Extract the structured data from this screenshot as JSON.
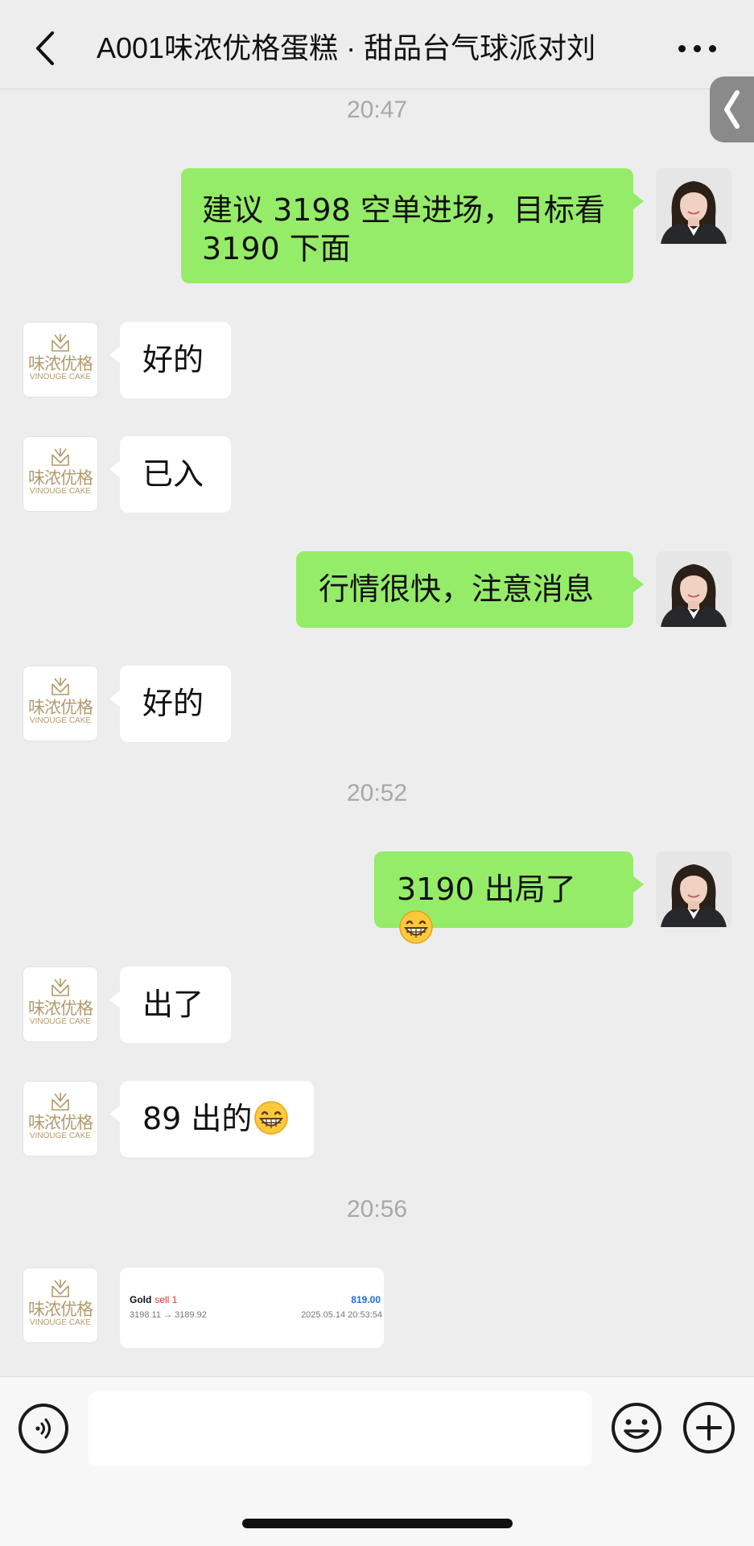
{
  "header": {
    "title": "A001味浓优格蛋糕 · 甜品台气球派对刘",
    "back_icon": "chevron-left-icon",
    "more_icon": "more-dots-icon"
  },
  "side_tab": {
    "icon": "chevron-left-icon"
  },
  "logo_avatar": {
    "name_cn": "味浓优格",
    "name_en": "VINOUGE CAKE",
    "color": "#B39A6C"
  },
  "messages": [
    {
      "type": "time",
      "text": "20:47"
    },
    {
      "type": "message",
      "side": "right",
      "lines": [
        "建议 3198 空单进场，目标看",
        "3190 下面"
      ]
    },
    {
      "type": "message",
      "side": "left",
      "text": "好的"
    },
    {
      "type": "message",
      "side": "left",
      "text": "已入"
    },
    {
      "type": "message",
      "side": "right",
      "text": "行情很快，注意消息"
    },
    {
      "type": "message",
      "side": "left",
      "text": "好的"
    },
    {
      "type": "time",
      "text": "20:52"
    },
    {
      "type": "message",
      "side": "right",
      "text": "3190 出局了",
      "emoji": "grinning-face-icon"
    },
    {
      "type": "message",
      "side": "left",
      "text": "出了"
    },
    {
      "type": "message",
      "side": "left",
      "text": "89 出的",
      "emoji": "grinning-face-icon"
    },
    {
      "type": "time",
      "text": "20:56"
    },
    {
      "type": "trade_card",
      "side": "left",
      "symbol": "Gold",
      "side_label": "sell 1",
      "prices": "3198.11 → 3189.92",
      "profit": "819.00",
      "timestamp": "2025.05.14 20:53:54"
    }
  ],
  "input_bar": {
    "placeholder": "",
    "voice_icon": "voice-icon",
    "emoji_icon": "smiley-icon",
    "plus_icon": "plus-icon"
  },
  "colors": {
    "background": "#EDEDED",
    "outgoing_bubble": "#95EC69",
    "incoming_bubble": "#FFFFFF",
    "timestamp_text": "#A8A8A8",
    "profit": "#1E6FD9",
    "sell": "#E03030"
  }
}
